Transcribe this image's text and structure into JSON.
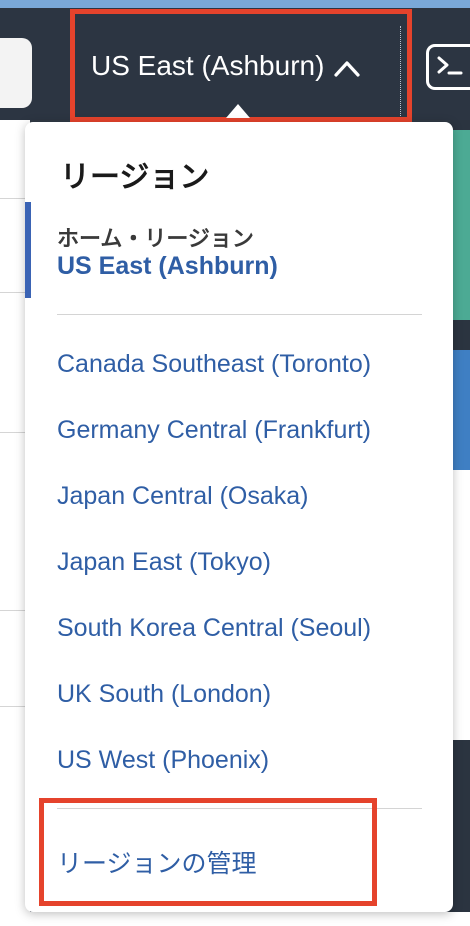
{
  "header": {
    "region_button_label": "US East (Ashburn)",
    "region_button_icon": "chevron-up-icon",
    "cloud_shell_icon": "terminal-icon"
  },
  "region_menu": {
    "title": "リージョン",
    "home_label": "ホーム・リージョン",
    "home_region": "US East (Ashburn)",
    "regions": [
      {
        "label": "Canada Southeast (Toronto)"
      },
      {
        "label": "Germany Central (Frankfurt)"
      },
      {
        "label": "Japan Central (Osaka)"
      },
      {
        "label": "Japan East (Tokyo)"
      },
      {
        "label": "South Korea Central (Seoul)"
      },
      {
        "label": "UK South (London)"
      },
      {
        "label": "US West (Phoenix)"
      }
    ],
    "manage_link": "リージョンの管理"
  },
  "colors": {
    "highlight": "#e5432c",
    "link": "#2f5ea5",
    "header_bg": "#2c3542"
  }
}
